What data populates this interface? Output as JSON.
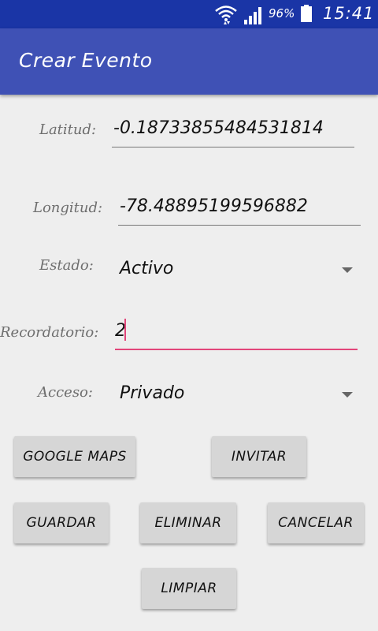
{
  "status_bar": {
    "battery_percent": "96%",
    "time": "15:41"
  },
  "app_bar": {
    "title": "Crear Evento"
  },
  "form": {
    "latitud": {
      "label": "Latitud:",
      "value": "-0.18733855484531814"
    },
    "longitud": {
      "label": "Longitud:",
      "value": "-78.48895199596882"
    },
    "estado": {
      "label": "Estado:",
      "value": "Activo"
    },
    "recordatorio": {
      "label": "Recordatorio:",
      "value": "2"
    },
    "acceso": {
      "label": "Acceso:",
      "value": "Privado"
    }
  },
  "buttons": {
    "google_maps": "GOOGLE MAPS",
    "invitar": "INVITAR",
    "guardar": "GUARDAR",
    "eliminar": "ELIMINAR",
    "cancelar": "CANCELAR",
    "limpiar": "LIMPIAR"
  },
  "colors": {
    "status_bar": "#1a35a6",
    "app_bar": "#3f51b5",
    "accent": "#e2457a",
    "button": "#d6d6d6"
  }
}
